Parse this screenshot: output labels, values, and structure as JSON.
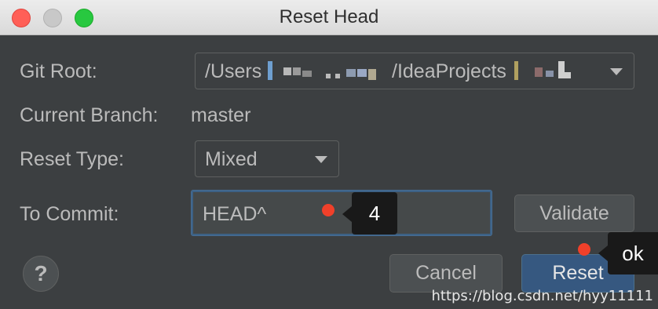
{
  "window": {
    "title": "Reset Head"
  },
  "form": {
    "git_root_label": "Git Root:",
    "git_root_value_prefix": "/Users",
    "git_root_value_middle": "/IdeaProjects",
    "current_branch_label": "Current Branch:",
    "current_branch_value": "master",
    "reset_type_label": "Reset Type:",
    "reset_type_value": "Mixed",
    "to_commit_label": "To Commit:",
    "to_commit_value": "HEAD^"
  },
  "buttons": {
    "validate": "Validate",
    "cancel": "Cancel",
    "reset": "Reset",
    "help": "?"
  },
  "annotations": {
    "tip_commit": "4",
    "tip_reset": "ok",
    "dot_color": "#f0402a"
  },
  "watermark": "https://blog.csdn.net/hyy11111",
  "colors": {
    "background": "#3c3f41",
    "accent": "#365880",
    "focus_border": "#3d6185"
  }
}
